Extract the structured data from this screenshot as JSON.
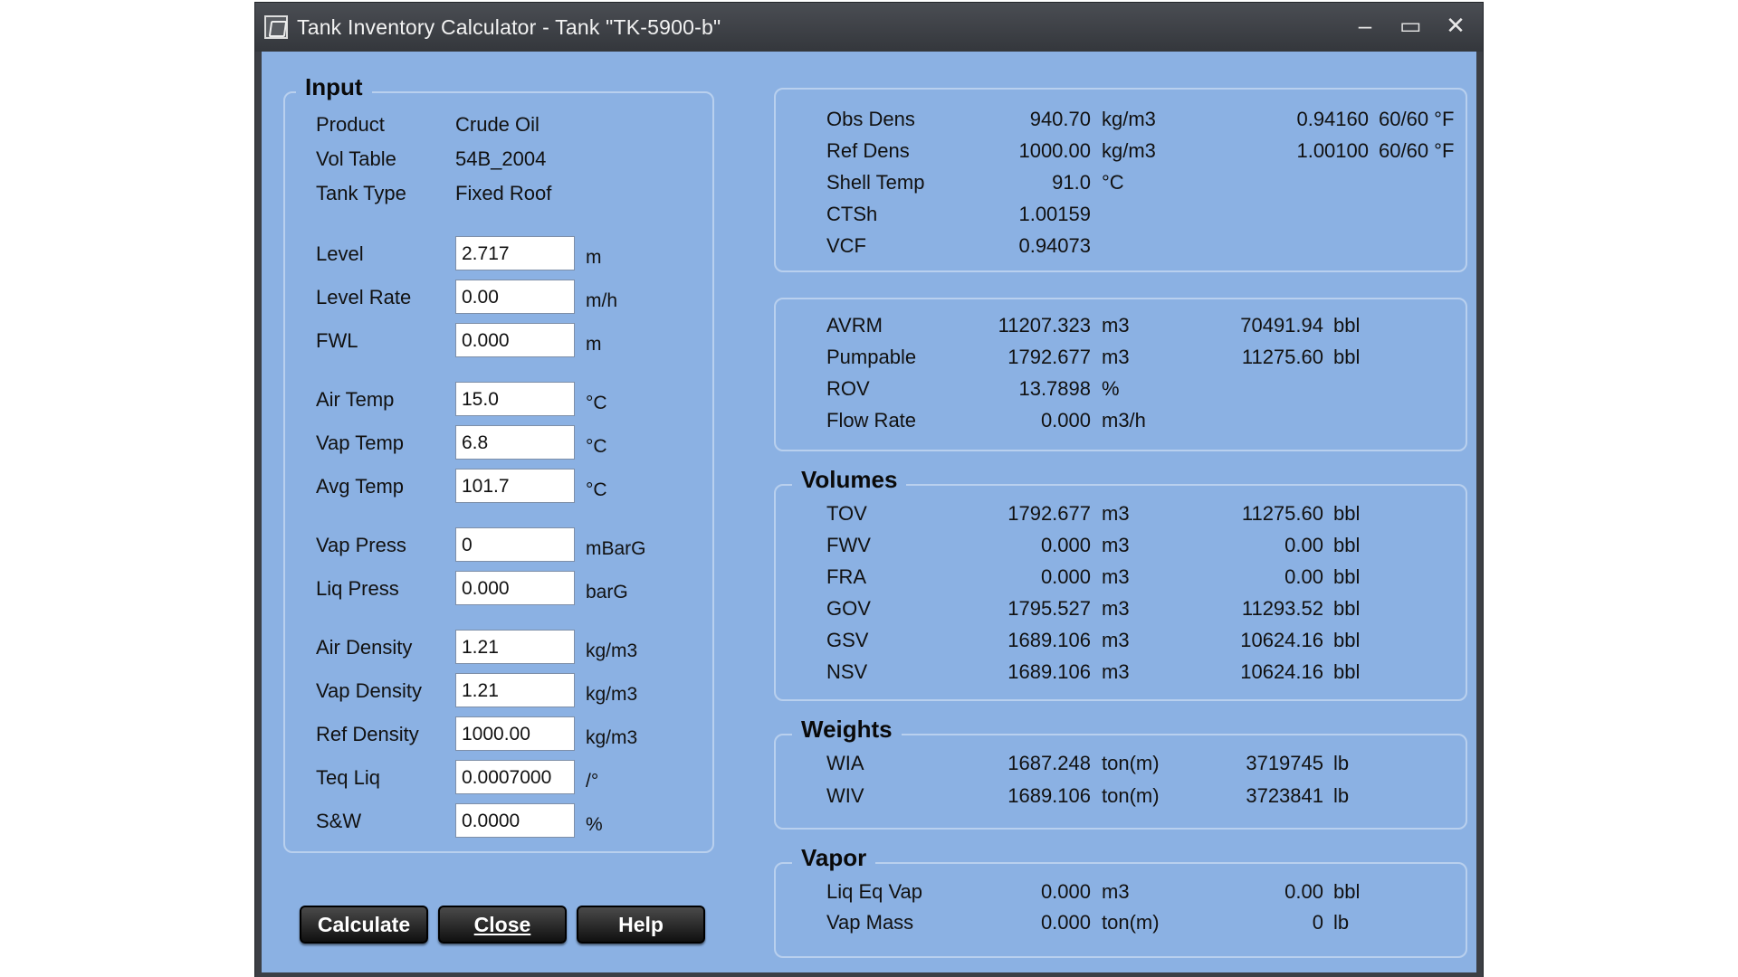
{
  "window": {
    "title": "Tank Inventory Calculator - Tank \"TK-5900-b\"",
    "minimize": "–",
    "maximize": "▭",
    "close": "✕"
  },
  "input": {
    "title": "Input",
    "info": [
      {
        "label": "Product",
        "value": "Crude Oil"
      },
      {
        "label": "Vol Table",
        "value": "54B_2004"
      },
      {
        "label": "Tank Type",
        "value": "Fixed Roof"
      }
    ],
    "fields": [
      {
        "label": "Level",
        "value": "2.717",
        "unit": "m"
      },
      {
        "label": "Level Rate",
        "value": "0.00",
        "unit": "m/h"
      },
      {
        "label": "FWL",
        "value": "0.000",
        "unit": "m"
      },
      {
        "label": "Air Temp",
        "value": "15.0",
        "unit": "°C"
      },
      {
        "label": "Vap Temp",
        "value": "6.8",
        "unit": "°C"
      },
      {
        "label": "Avg Temp",
        "value": "101.7",
        "unit": "°C"
      },
      {
        "label": "Vap Press",
        "value": "0",
        "unit": "mBarG"
      },
      {
        "label": "Liq Press",
        "value": "0.000",
        "unit": "barG"
      },
      {
        "label": "Air Density",
        "value": "1.21",
        "unit": "kg/m3"
      },
      {
        "label": "Vap Density",
        "value": "1.21",
        "unit": "kg/m3"
      },
      {
        "label": "Ref Density",
        "value": "1000.00",
        "unit": "kg/m3"
      },
      {
        "label": "Teq Liq",
        "value": "0.0007000",
        "unit": "/°"
      },
      {
        "label": "S&W",
        "value": "0.0000",
        "unit": "%"
      }
    ]
  },
  "buttons": {
    "calculate": "Calculate",
    "close": "Close",
    "help": "Help"
  },
  "density": {
    "rows": [
      {
        "label": "Obs Dens",
        "v1": "940.70",
        "u1": "kg/m3",
        "v2": "0.94160",
        "u2": "60/60 °F"
      },
      {
        "label": "Ref Dens",
        "v1": "1000.00",
        "u1": "kg/m3",
        "v2": "1.00100",
        "u2": "60/60 °F"
      },
      {
        "label": "Shell Temp",
        "v1": "91.0",
        "u1": "°C",
        "v2": "",
        "u2": ""
      },
      {
        "label": "CTSh",
        "v1": "1.00159",
        "u1": "",
        "v2": "",
        "u2": ""
      },
      {
        "label": "VCF",
        "v1": "0.94073",
        "u1": "",
        "v2": "",
        "u2": ""
      }
    ]
  },
  "avrm": {
    "rows": [
      {
        "label": "AVRM",
        "v1": "11207.323",
        "u1": "m3",
        "v2": "70491.94",
        "u2": "bbl"
      },
      {
        "label": "Pumpable",
        "v1": "1792.677",
        "u1": "m3",
        "v2": "11275.60",
        "u2": "bbl"
      },
      {
        "label": "ROV",
        "v1": "13.7898",
        "u1": "%",
        "v2": "",
        "u2": ""
      },
      {
        "label": "Flow Rate",
        "v1": "0.000",
        "u1": "m3/h",
        "v2": "",
        "u2": ""
      }
    ]
  },
  "volumes": {
    "title": "Volumes",
    "rows": [
      {
        "label": "TOV",
        "v1": "1792.677",
        "u1": "m3",
        "v2": "11275.60",
        "u2": "bbl"
      },
      {
        "label": "FWV",
        "v1": "0.000",
        "u1": "m3",
        "v2": "0.00",
        "u2": "bbl"
      },
      {
        "label": "FRA",
        "v1": "0.000",
        "u1": "m3",
        "v2": "0.00",
        "u2": "bbl"
      },
      {
        "label": "GOV",
        "v1": "1795.527",
        "u1": "m3",
        "v2": "11293.52",
        "u2": "bbl"
      },
      {
        "label": "GSV",
        "v1": "1689.106",
        "u1": "m3",
        "v2": "10624.16",
        "u2": "bbl"
      },
      {
        "label": "NSV",
        "v1": "1689.106",
        "u1": "m3",
        "v2": "10624.16",
        "u2": "bbl"
      }
    ]
  },
  "weights": {
    "title": "Weights",
    "rows": [
      {
        "label": "WIA",
        "v1": "1687.248",
        "u1": "ton(m)",
        "v2": "3719745",
        "u2": "lb"
      },
      {
        "label": "WIV",
        "v1": "1689.106",
        "u1": "ton(m)",
        "v2": "3723841",
        "u2": "lb"
      }
    ]
  },
  "vapor": {
    "title": "Vapor",
    "rows": [
      {
        "label": "Liq Eq Vap",
        "v1": "0.000",
        "u1": "m3",
        "v2": "0.00",
        "u2": "bbl"
      },
      {
        "label": "Vap Mass",
        "v1": "0.000",
        "u1": "ton(m)",
        "v2": "0",
        "u2": "lb"
      }
    ]
  }
}
